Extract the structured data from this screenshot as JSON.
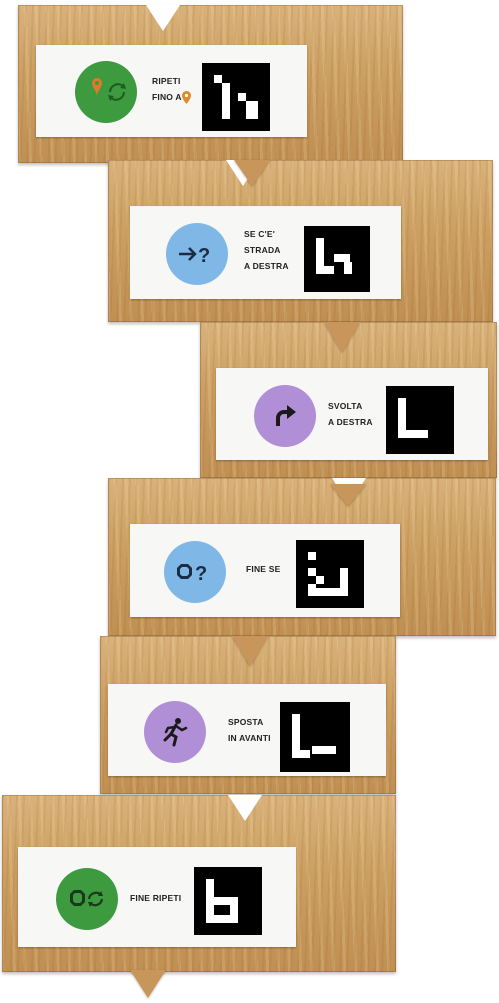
{
  "blocks": [
    {
      "lines": [
        "RIPETI",
        "FINO A"
      ],
      "icon": "green-circle-repeat-until-icon",
      "color": "#3d9a3f"
    },
    {
      "lines": [
        "SE C'E'",
        "STRADA",
        "A DESTRA"
      ],
      "icon": "blue-circle-arrow-question-icon",
      "color": "#7fb7e6"
    },
    {
      "lines": [
        "SVOLTA",
        "A DESTRA"
      ],
      "icon": "purple-circle-turn-right-icon",
      "color": "#b08fd6"
    },
    {
      "lines": [
        "FINE SE"
      ],
      "icon": "blue-circle-stop-question-icon",
      "color": "#7fb7e6"
    },
    {
      "lines": [
        "SPOSTA",
        "IN AVANTI"
      ],
      "icon": "purple-circle-running-man-icon",
      "color": "#b08fd6"
    },
    {
      "lines": [
        "FINE RIPETI"
      ],
      "icon": "green-circle-end-repeat-icon",
      "color": "#3d9a3f"
    }
  ]
}
